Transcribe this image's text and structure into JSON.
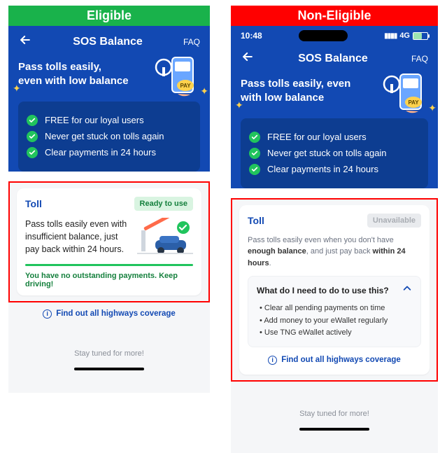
{
  "banners": {
    "eligible": "Eligible",
    "non_eligible": "Non-Eligible"
  },
  "status": {
    "time": "10:48",
    "network": "4G",
    "battery_pct": 60
  },
  "nav": {
    "title": "SOS Balance",
    "faq": "FAQ"
  },
  "hero": {
    "title_multiline": "Pass tolls easily,\neven with low balance",
    "title_wide": "Pass tolls easily, even with low balance",
    "pay_label": "PAY"
  },
  "benefits": [
    "FREE for our loyal users",
    "Never get stuck on tolls again",
    "Clear payments in 24 hours"
  ],
  "eligible_card": {
    "title": "Toll",
    "badge": "Ready to use",
    "text": "Pass tolls easily even with insufficient balance, just pay back within 24 hours.",
    "ok_message": "You have no outstanding payments. Keep driving!"
  },
  "noneligible_card": {
    "title": "Toll",
    "badge": "Unavailable",
    "desc_pre": "Pass tolls easily even when you don't have ",
    "desc_bold1": "enough balance",
    "desc_mid": ", and just pay back ",
    "desc_bold2": "within 24 hours",
    "desc_post": ".",
    "sub_title": "What do I need to do to use this?",
    "tips": [
      "Clear all pending payments on time",
      "Add money to your eWallet regularly",
      "Use TNG eWallet actively"
    ]
  },
  "coverage_link": "Find out all highways coverage",
  "stay_tuned": "Stay tuned for more!"
}
